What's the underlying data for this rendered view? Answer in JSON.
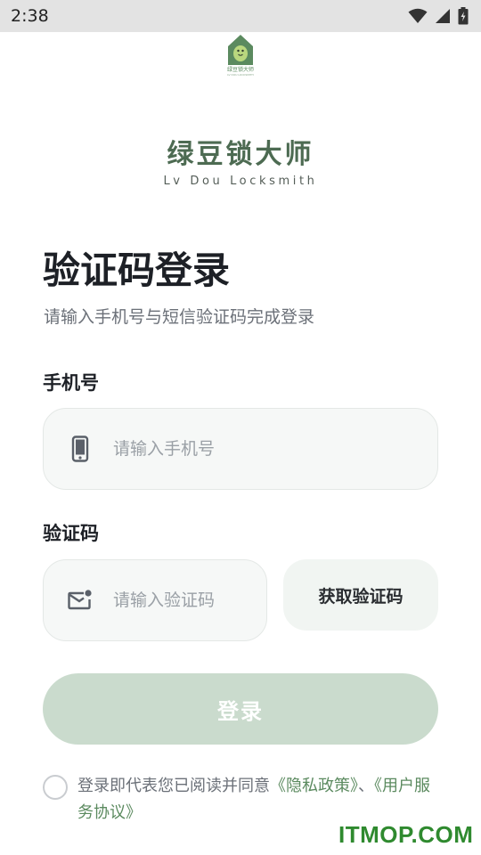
{
  "status_bar": {
    "time": "2:38"
  },
  "logo": {
    "caption": "绿豆锁大师",
    "sub": "LV DOU LOCKSMITH"
  },
  "brand": {
    "title": "绿豆锁大师",
    "subtitle": "Lv Dou Locksmith"
  },
  "page": {
    "title": "验证码登录",
    "subtitle": "请输入手机号与短信验证码完成登录"
  },
  "phone": {
    "label": "手机号",
    "placeholder": "请输入手机号",
    "icon": "phone-icon"
  },
  "code": {
    "label": "验证码",
    "placeholder": "请输入验证码",
    "icon": "mail-icon",
    "button_label": "获取验证码"
  },
  "login": {
    "button_label": "登录"
  },
  "agreement": {
    "prefix": "登录即代表您已阅读并同意",
    "privacy_link": "《隐私政策》",
    "separator": "、",
    "terms_link": "《用户服务协议》"
  },
  "watermark": "ITMOP.COM",
  "colors": {
    "brand_green": "#4d6b52",
    "button_disabled": "#cadbcd",
    "link_green": "#5b8a5f"
  }
}
